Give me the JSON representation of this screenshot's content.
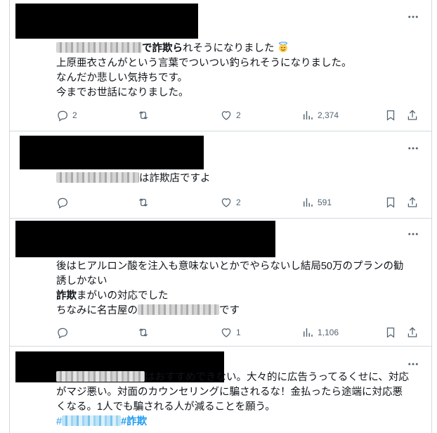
{
  "posts": [
    {
      "lines": [
        {
          "blur": 122,
          "bold": "で詐欺ら",
          "rest": "れそうになりました"
        },
        {
          "text": "上原亜衣さんがという言葉でついつい釣られそうになりました。"
        },
        {
          "text": "なんだか悲しい気持ちです。"
        },
        {
          "text": "今までお世話になりました。"
        }
      ],
      "emoji": "smiling-face-with-halo",
      "replies": "2",
      "likes": "2",
      "views": "2,374"
    },
    {
      "lines": [
        {
          "blur": 118,
          "pre": "",
          "bold": "は詐欺",
          "rest": "店ですよ"
        }
      ],
      "replies": "",
      "likes": "2",
      "views": "591"
    },
    {
      "lines": [
        {
          "text": "後はヒアルロン酸を注入も意味ないとかでやらないし結局50万のプランの勧"
        },
        {
          "text": "誘しかない"
        },
        {
          "bold": "詐欺",
          "rest": "まがいの対応でした"
        },
        {
          "pre": "ちなみに名古屋の",
          "blur": 116,
          "rest": "です"
        }
      ],
      "replies": "",
      "likes": "1",
      "views": "1,106"
    },
    {
      "lines": [
        {
          "blur": 126,
          "rest": "はおすすめできない。大々的に広告うってるくせに、対応"
        },
        {
          "text": "がマジ悪い。対面のカウンセリングに騙されるな！金払ったら途端に対応悪"
        },
        {
          "text": "くなる。1人でも騙される人が減ることを願う。"
        }
      ],
      "hashtags": [
        "#",
        "#詐欺"
      ]
    }
  ],
  "icons": {
    "more": "more-horizontal-icon",
    "reply": "reply-icon",
    "retweet": "retweet-icon",
    "like": "heart-icon",
    "views": "analytics-icon",
    "bookmark": "bookmark-icon",
    "share": "share-icon"
  },
  "colors": {
    "text": "#0f1419",
    "muted": "#536471",
    "link": "#1d9bf0",
    "border": "#cfd9de"
  }
}
